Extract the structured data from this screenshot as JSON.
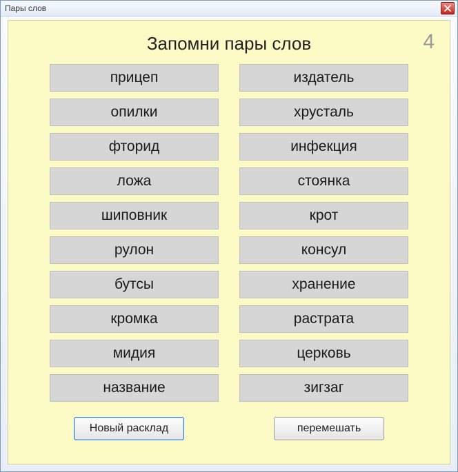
{
  "window": {
    "title": "Пары слов"
  },
  "header": {
    "title": "Запомни пары слов",
    "counter": "4"
  },
  "pairs": {
    "left": [
      "прицеп",
      "опилки",
      "фторид",
      "ложа",
      "шиповник",
      "рулон",
      "бутсы",
      "кромка",
      "мидия",
      "название"
    ],
    "right": [
      "издатель",
      "хрусталь",
      "инфекция",
      "стоянка",
      "крот",
      "консул",
      "хранение",
      "растрата",
      "церковь",
      "зигзаг"
    ]
  },
  "footer": {
    "new_deal": "Новый расклад",
    "shuffle": "перемешать"
  }
}
